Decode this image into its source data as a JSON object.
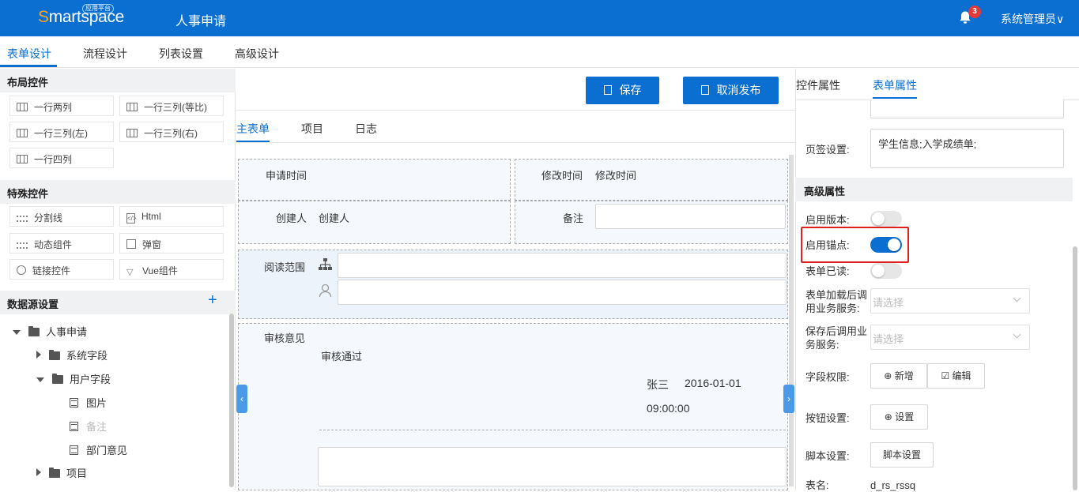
{
  "header": {
    "logo_text": "Smartspace",
    "logo_badge": "应用平台",
    "app_title": "人事申请",
    "notification_count": "3",
    "user_menu": "系统管理员∨"
  },
  "main_tabs": [
    "表单设计",
    "流程设计",
    "列表设置",
    "高级设计"
  ],
  "left": {
    "layout_title": "布局控件",
    "layout_controls": [
      "一行两列",
      "一行三列(等比)",
      "一行三列(左)",
      "一行三列(右)",
      "一行四列"
    ],
    "special_title": "特殊控件",
    "special_controls": [
      "分割线",
      "Html",
      "动态组件",
      "弹窗",
      "链接控件",
      "Vue组件"
    ],
    "datasource_title": "数据源设置",
    "datasource_add": "+",
    "tree": [
      "人事申请",
      "系统字段",
      "用户字段",
      "图片",
      "备注",
      "部门意见",
      "项目"
    ]
  },
  "toolbar": {
    "save": "保存",
    "unpublish": "取消发布"
  },
  "form_tabs": [
    "主表单",
    "项目",
    "日志"
  ],
  "form": {
    "apply_time_label": "申请时间",
    "modify_time_label": "修改时间",
    "modify_time_value": "修改时间",
    "creator_label": "创建人",
    "creator_value": "创建人",
    "remark_label": "备注",
    "read_scope_label": "阅读范围",
    "review_label": "审核意见",
    "review_result": "审核通过",
    "reviewer": "张三",
    "review_date": "2016-01-01",
    "review_time": "09:00:00"
  },
  "right": {
    "tabs": [
      "控件属性",
      "表单属性"
    ],
    "tab_label": "页签设置:",
    "tab_value": "学生信息;入学成绩单;",
    "advanced_title": "高级属性",
    "enable_version": "启用版本:",
    "enable_anchor": "启用锚点:",
    "form_read": "表单已读:",
    "after_load_service": "表单加载后调用业务服务:",
    "after_save_service": "保存后调用业务服务:",
    "select_placeholder": "请选择",
    "field_perm": "字段权限:",
    "add_btn": "新增",
    "edit_btn": "编辑",
    "button_settings": "按钮设置:",
    "settings_btn": "设置",
    "script_settings": "脚本设置:",
    "script_btn": "脚本设置",
    "table_name_label": "表名:",
    "table_name_value": "d_rs_rssq",
    "toggles": {
      "version": false,
      "anchor": true,
      "read": false
    }
  }
}
